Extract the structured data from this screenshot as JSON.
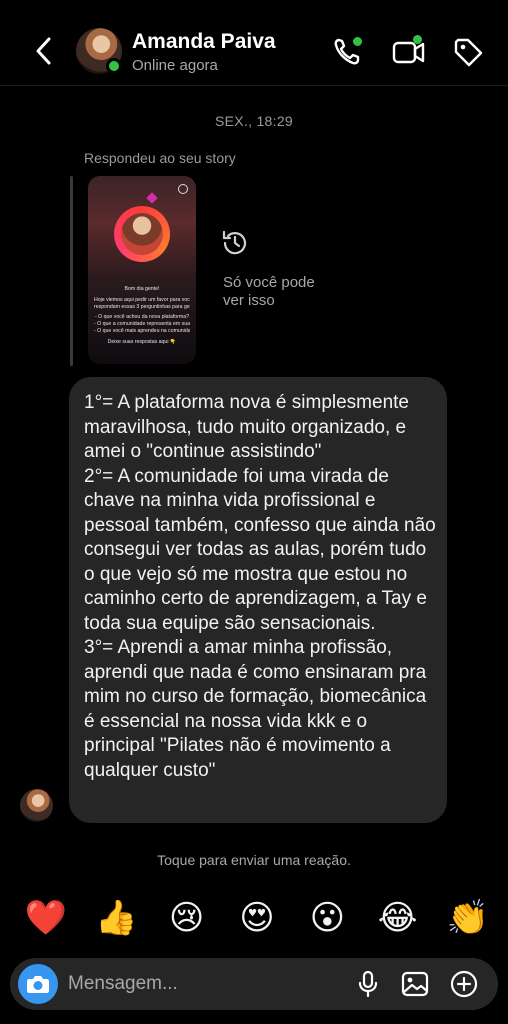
{
  "header": {
    "contact_name": "Amanda Paiva",
    "status": "Online agora",
    "icons": [
      "back-arrow-icon",
      "phone-icon",
      "video-icon",
      "tag-icon"
    ],
    "accent_color": "#32c346"
  },
  "conversation": {
    "timestamp": "SEX., 18:29",
    "reply_label": "Respondeu ao seu story",
    "story": {
      "greeting": "Bom dia gente!",
      "intro_lines": [
        "Hoje viemos aqui pedir um favor para vocês,",
        "respondam essas 3 perguntinhas para gente 😊"
      ],
      "question_lines": [
        "- O que você achou da nova plataforma?",
        "- O que a comunidade representa em sua vida?",
        "- O que você mais aprendeu na comunidade?"
      ],
      "cta": "Deixe suas respostas aqui 👇"
    },
    "hidden_media_text": "Só você pode\nver isso",
    "message_text": "1°= A plataforma nova é simplesmente maravilhosa, tudo muito organizado, e amei o \"continue assistindo\"\n2°= A comunidade foi uma virada de chave na minha vida profissional e pessoal também, confesso que ainda não consegui ver todas as aulas, porém tudo o que vejo só me mostra que estou no caminho certo de aprendizagem, a Tay e toda sua equipe são sensacionais.\n3°= Aprendi a amar minha profissão, aprendi que nada é como ensinaram pra mim no curso de formação, biomecânica é essencial na nossa vida kkk e o principal \"Pilates não é movimento a qualquer custo\""
  },
  "reactions": {
    "hint": "Toque para enviar uma reação.",
    "emojis": [
      "❤️",
      "👍",
      "😢",
      "😍",
      "😮",
      "😂",
      "👏"
    ]
  },
  "composer": {
    "placeholder": "Mensagem...",
    "camera_color": "#3797f0",
    "icons": [
      "camera-icon",
      "microphone-icon",
      "gallery-icon",
      "add-icon"
    ]
  }
}
